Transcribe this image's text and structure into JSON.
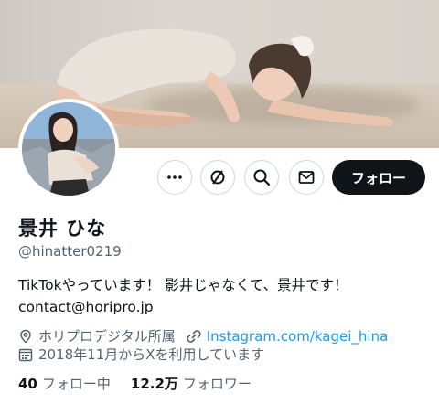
{
  "profile": {
    "display_name": "景井 ひな",
    "handle": "@hinatter0219",
    "bio_line1": "TikTokやっています！ 影井じゃなくて、景井です！",
    "bio_line2": "contact@horipro.jp",
    "affiliation": "ホリプロデジタル所属",
    "link_text": "Instagram.com/kagei_hina",
    "joined": "2018年11月からXを利用しています"
  },
  "actions": {
    "more_icon": "more-icon",
    "grok_icon": "grok-icon",
    "search_icon": "search-icon",
    "message_icon": "mail-icon",
    "follow_label": "フォロー"
  },
  "stats": {
    "following_count": "40",
    "following_label": "フォロー中",
    "followers_count": "12.2万",
    "followers_label": "フォロワー"
  },
  "colors": {
    "accent_link": "#1d9bf0",
    "text_primary": "#0f1419",
    "text_secondary": "#536471",
    "button_dark": "#0f1419"
  }
}
